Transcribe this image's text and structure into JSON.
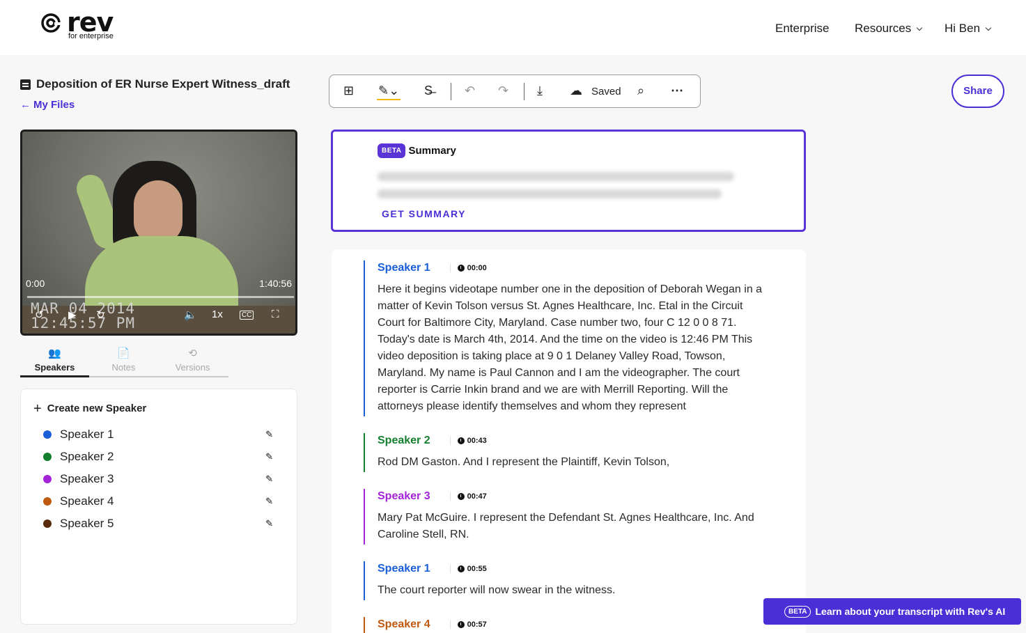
{
  "brand": {
    "name": "rev",
    "sub": "for enterprise"
  },
  "nav": {
    "enterprise": "Enterprise",
    "resources": "Resources",
    "user": "Hi Ben"
  },
  "file": {
    "title": "Deposition of ER Nurse Expert Witness_draft",
    "back_label": "My Files"
  },
  "video": {
    "current_time": "0:00",
    "duration": "1:40:56",
    "speed": "1x",
    "cc": "CC",
    "stamp_line1": "MAR 04 2014",
    "stamp_line2": "12:45:57 PM"
  },
  "tabs": [
    {
      "label": "Speakers",
      "icon": "speakers-icon",
      "active": true
    },
    {
      "label": "Notes",
      "icon": "notes-icon",
      "active": false
    },
    {
      "label": "Versions",
      "icon": "history-icon",
      "active": false
    }
  ],
  "speakers_panel": {
    "create_label": "Create new Speaker",
    "items": [
      {
        "name": "Speaker 1",
        "color": "#1a5fd8"
      },
      {
        "name": "Speaker 2",
        "color": "#14802f"
      },
      {
        "name": "Speaker 3",
        "color": "#a323d6"
      },
      {
        "name": "Speaker 4",
        "color": "#c05a10"
      },
      {
        "name": "Speaker 5",
        "color": "#5a2a0c"
      }
    ]
  },
  "toolbar": {
    "saved_label": "Saved"
  },
  "share_label": "Share",
  "summary": {
    "badge": "BETA",
    "title": "Summary",
    "cta": "GET SUMMARY"
  },
  "transcript": [
    {
      "speaker": "Speaker 1",
      "color": "#1a5fd8",
      "time": "00:00",
      "text": "Here it begins videotape number one in the deposition of Deborah Wegan in a matter of Kevin Tolson versus St. Agnes Healthcare, Inc. Etal in the Circuit Court for Baltimore City, Maryland. Case number two, four C 12 0 0 8 71. Today's date is March 4th, 2014. And the time on the video is 12:46 PM This video deposition is taking place at 9 0 1 Delaney Valley Road, Towson, Maryland. My name is Paul Cannon and I am the videographer. The court reporter is Carrie Inkin brand and we are with Merrill Reporting. Will the attorneys please identify themselves and whom they represent"
    },
    {
      "speaker": "Speaker 2",
      "color": "#14802f",
      "time": "00:43",
      "text": "Rod DM Gaston. And I represent the Plaintiff, Kevin Tolson,"
    },
    {
      "speaker": "Speaker 3",
      "color": "#a323d6",
      "time": "00:47",
      "text": "Mary Pat McGuire. I represent the Defendant St. Agnes Healthcare, Inc. And Caroline Stell, RN."
    },
    {
      "speaker": "Speaker 1",
      "color": "#1a5fd8",
      "time": "00:55",
      "text": "The court reporter will now swear in the witness."
    },
    {
      "speaker": "Speaker 4",
      "color": "#c05a10",
      "time": "00:57",
      "text": ""
    }
  ],
  "ai_banner": {
    "badge": "BETA",
    "text": "Learn about your transcript with Rev's AI"
  }
}
